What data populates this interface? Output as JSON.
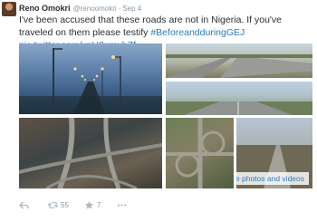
{
  "tweet": {
    "author_name": "Reno Omokri",
    "author_handle": "@renoomokri",
    "separator": "·",
    "date": "Sep 4",
    "text_plain": "I've been accused that these roads are not in Nigeria. If you've traveled on them please testify ",
    "hashtag": "#BeforeandduringGEJ",
    "link": "pic.twitter.com/xpU2umybZf",
    "view_more": "View more photos and videos"
  },
  "actions": {
    "retweet_count": "55",
    "favorite_count": "7"
  },
  "colors": {
    "link": "#2b7bb9",
    "meta": "#8899a6",
    "text": "#292f33"
  }
}
